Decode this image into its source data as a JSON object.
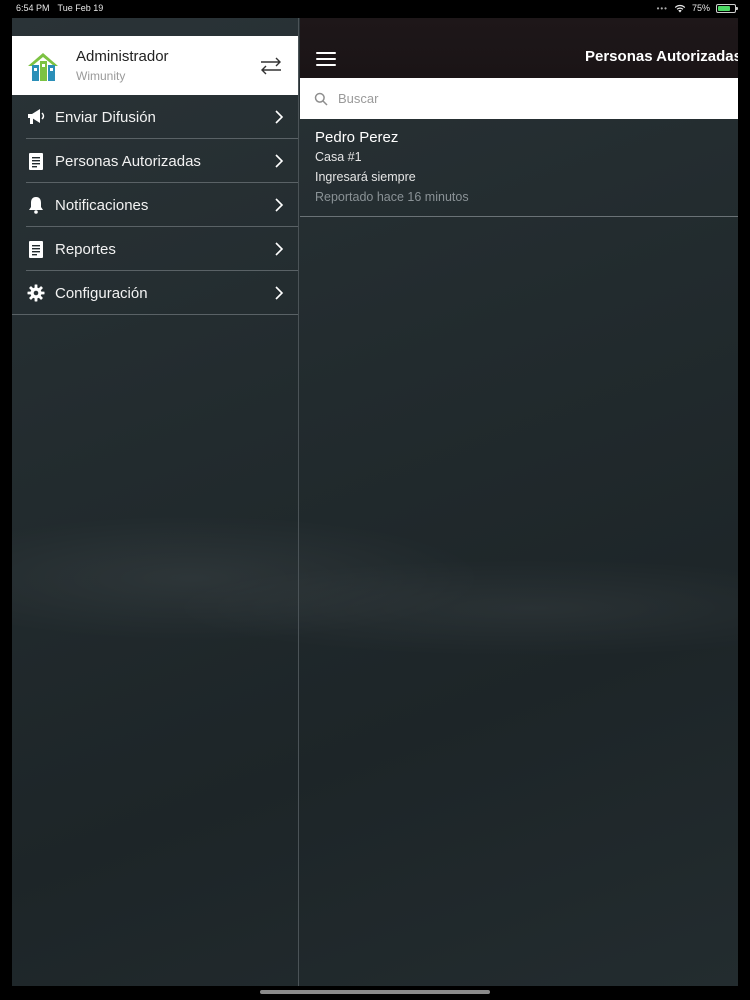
{
  "status_bar": {
    "time": "6:54 PM",
    "date": "Tue Feb 19",
    "battery_percent": "75%",
    "battery_level": 0.75
  },
  "sidebar": {
    "profile": {
      "name": "Administrador",
      "subtitle": "Wimunity",
      "logo_icon": "building-logo",
      "action_icon": "swap-arrows-icon"
    },
    "items": [
      {
        "label": "Enviar Difusión",
        "icon": "megaphone-icon"
      },
      {
        "label": "Personas Autorizadas",
        "icon": "document-icon"
      },
      {
        "label": "Notificaciones",
        "icon": "bell-icon"
      },
      {
        "label": "Reportes",
        "icon": "document-icon"
      },
      {
        "label": "Configuración",
        "icon": "gear-icon"
      }
    ]
  },
  "main": {
    "title": "Personas Autorizadas",
    "search": {
      "placeholder": "Buscar",
      "value": ""
    },
    "list": [
      {
        "name": "Pedro Perez",
        "house": "Casa #1",
        "schedule": "Ingresará siempre",
        "reported": "Reportado hace 16 minutos"
      }
    ]
  },
  "colors": {
    "background_dark": "#232c2f",
    "topbar": "#1a1416",
    "divider": "#5a6266",
    "logo_green": "#7cc242",
    "logo_blue": "#2b8fb8"
  }
}
